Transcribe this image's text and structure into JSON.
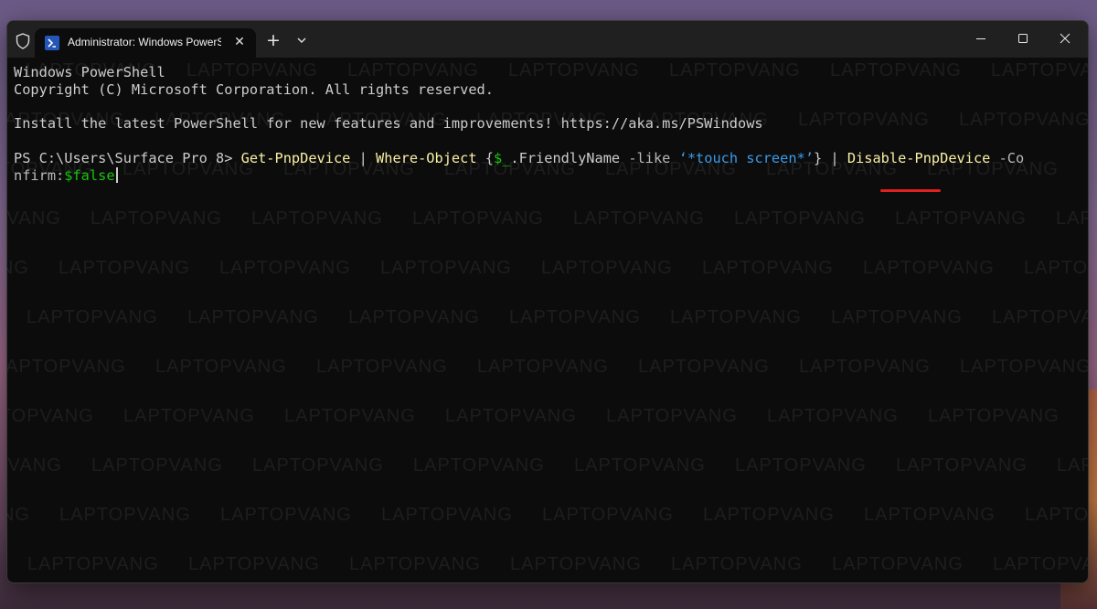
{
  "tab": {
    "title": "Administrator: Windows PowerShell",
    "icon": "powershell-icon",
    "close": "✕"
  },
  "titlebar": {
    "new_tab": "+",
    "icons": [
      "shield-icon",
      "chevron-down-icon",
      "minimize-icon",
      "maximize-icon",
      "close-icon"
    ]
  },
  "terminal": {
    "header_line1": "Windows PowerShell",
    "header_line2": "Copyright (C) Microsoft Corporation. All rights reserved.",
    "header_line3": "Install the latest PowerShell for new features and improvements! https://aka.ms/PSWindows",
    "prompt": "PS C:\\Users\\Surface Pro 8> ",
    "cmd1": "Get-PnpDevice",
    "pipe1": " | ",
    "cmd2": "Where-Object",
    "block_open": " {",
    "var1": "$_",
    "prop": ".FriendlyName ",
    "op": "-like",
    "str": " ‘*touch screen*’",
    "block_close": "} | ",
    "cmd3": "Disable-PnpDevice",
    "param_part1": " -Co",
    "param_part2": "nfirm:",
    "var2": "$false"
  },
  "watermark": "LAPTOPVANG",
  "colors": {
    "background": "#0c0c0c",
    "text": "#cccccc",
    "command": "#f9f1a5",
    "string": "#3b9ae8",
    "variable": "#16c60c",
    "highlight_underline": "#e32020"
  }
}
